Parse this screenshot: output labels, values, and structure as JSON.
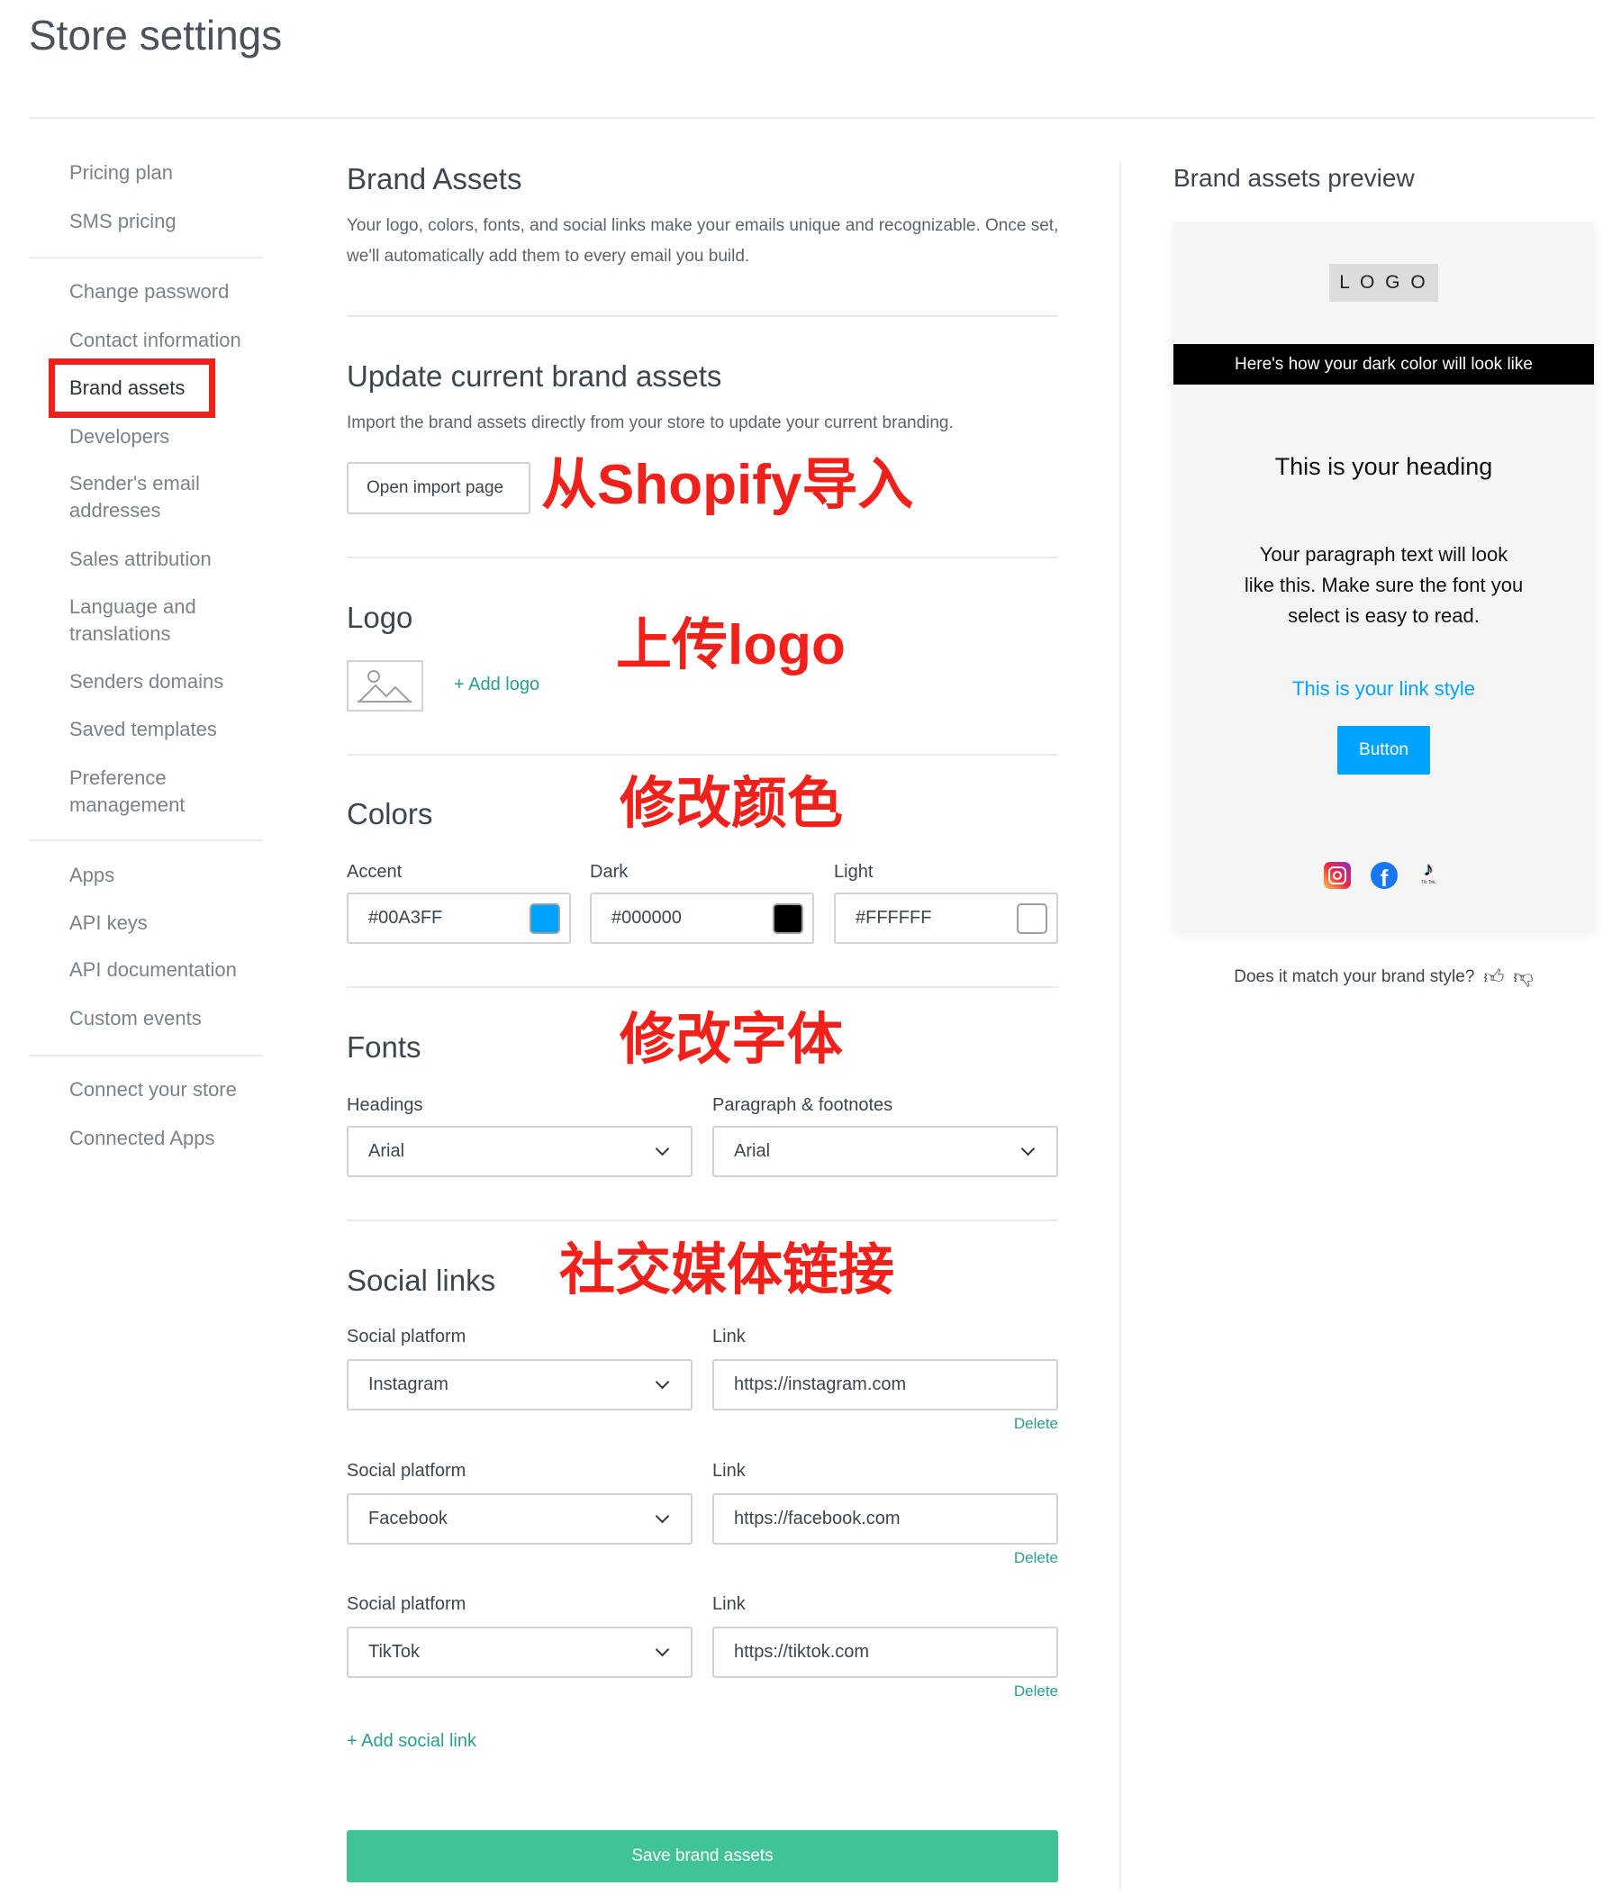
{
  "page": {
    "title": "Store settings"
  },
  "sidebar": {
    "items": [
      "Pricing plan",
      "SMS pricing",
      "Change password",
      "Contact information",
      "Brand assets",
      "Developers",
      "Sender's email addresses",
      "Sales attribution",
      "Language and translations",
      "Senders domains",
      "Saved templates",
      "Preference management",
      "Apps",
      "API keys",
      "API documentation",
      "Custom events",
      "Connect your store",
      "Connected Apps"
    ],
    "active": "Brand assets"
  },
  "brand": {
    "title": "Brand Assets",
    "desc": "Your logo, colors, fonts, and social links make your emails unique and recognizable. Once set, we'll automatically add them to every email you build."
  },
  "update": {
    "title": "Update current brand assets",
    "desc": "Import the brand assets directly from your store to update your current branding.",
    "button": "Open import page",
    "annotation": "从Shopify导入"
  },
  "logo": {
    "title": "Logo",
    "add": "+ Add logo",
    "annotation": "上传logo"
  },
  "colors": {
    "title": "Colors",
    "annotation": "修改颜色",
    "fields": [
      {
        "label": "Accent",
        "value": "#00A3FF",
        "color": "#00A3FF"
      },
      {
        "label": "Dark",
        "value": "#000000",
        "color": "#000000"
      },
      {
        "label": "Light",
        "value": "#FFFFFF",
        "color": "#FFFFFF"
      }
    ]
  },
  "fonts": {
    "title": "Fonts",
    "annotation": "修改字体",
    "headings_label": "Headings",
    "headings": "Arial",
    "paragraph_label": "Paragraph & footnotes",
    "paragraph": "Arial"
  },
  "social": {
    "title": "Social links",
    "annotation": "社交媒体链接",
    "platform_label": "Social platform",
    "link_label": "Link",
    "delete": "Delete",
    "rows": [
      {
        "platform": "Instagram",
        "link": "https://instagram.com"
      },
      {
        "platform": "Facebook",
        "link": "https://facebook.com"
      },
      {
        "platform": "TikTok",
        "link": "https://tiktok.com"
      }
    ],
    "add": "+ Add social link"
  },
  "save": {
    "label": "Save brand assets",
    "color": "#40C496"
  },
  "preview": {
    "title": "Brand assets preview",
    "logo": "L O G O",
    "dark_band": "Here's how your dark color will look like",
    "heading": "This is your heading",
    "paragraph": "Your paragraph text will look like this. Make sure the font you select is easy to read.",
    "link": "This is your link style",
    "button": "Button",
    "icons": [
      "instagram-icon",
      "facebook-icon",
      "tiktok-icon"
    ],
    "tiktok_caption": "Tik Tok",
    "feedback": "Does it match your brand style?"
  }
}
